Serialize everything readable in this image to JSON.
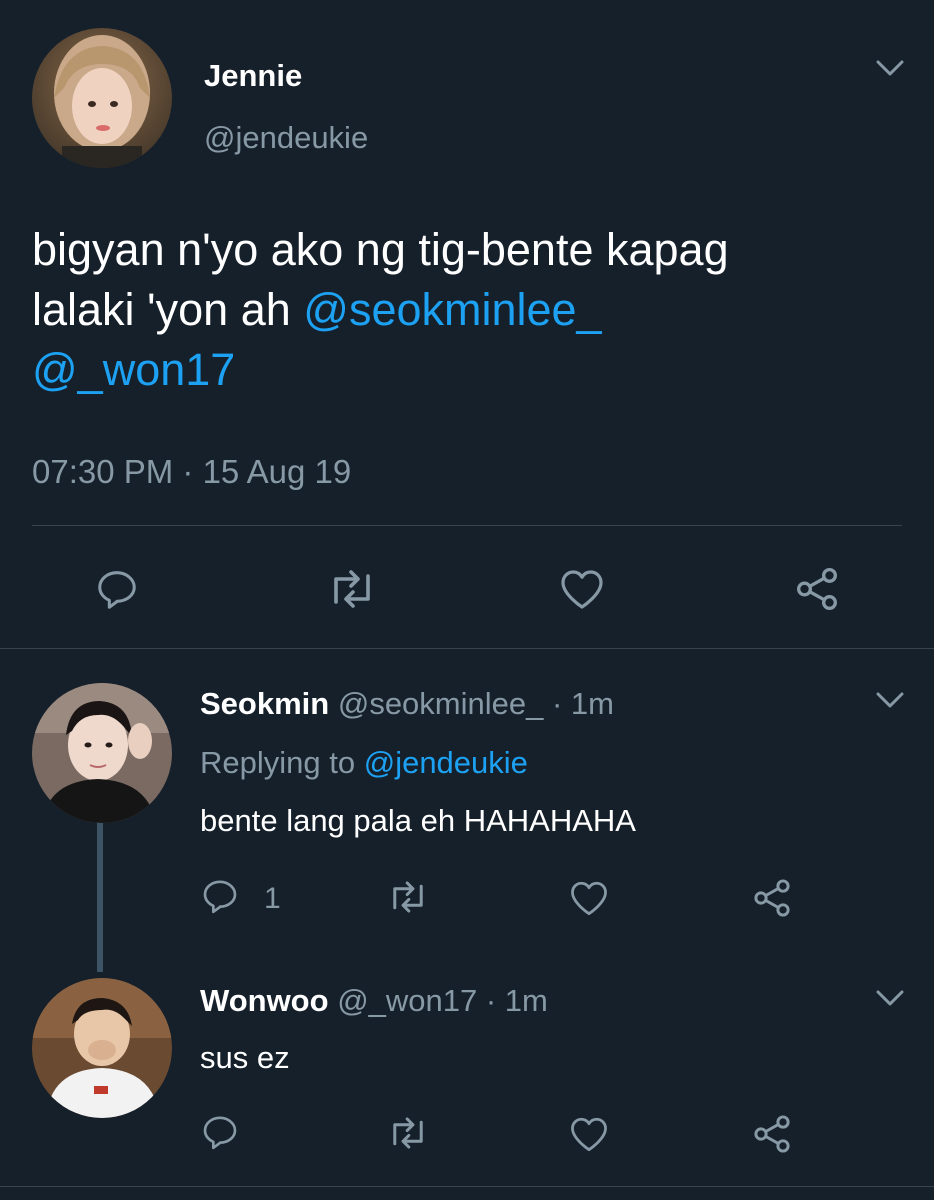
{
  "main_tweet": {
    "display_name": "Jennie",
    "handle": "@jendeukie",
    "text_part1": "bigyan n'yo ako ng tig-bente kapag",
    "text_part2": "lalaki 'yon ah ",
    "mention1": "@seokminlee_",
    "mention2": "@_won17",
    "timestamp": "07:30 PM · 15 Aug 19"
  },
  "replies": [
    {
      "display_name": "Seokmin",
      "meta": "@seokminlee_ · 1m",
      "replying_label": "Replying to ",
      "replying_handle": "@jendeukie",
      "text": "bente lang pala eh HAHAHAHA",
      "reply_count": "1"
    },
    {
      "display_name": "Wonwoo",
      "meta": "@_won17 · 1m",
      "text": "sus ez"
    }
  ],
  "colors": {
    "background": "#15202b",
    "muted": "#8899a6",
    "link": "#1da1f2",
    "divider": "#38444d"
  },
  "icons": [
    "reply-icon",
    "retweet-icon",
    "like-icon",
    "share-icon",
    "chevron-down-icon"
  ]
}
